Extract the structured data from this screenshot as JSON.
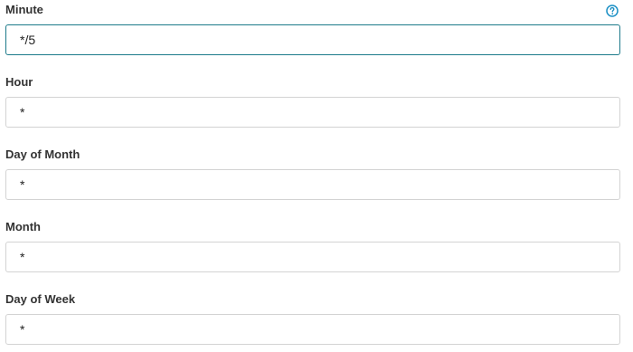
{
  "help_icon": "question-circle-icon",
  "accent_color": "#1c7a8a",
  "fields": [
    {
      "label": "Minute",
      "value": "*/5"
    },
    {
      "label": "Hour",
      "value": "*"
    },
    {
      "label": "Day of Month",
      "value": "*"
    },
    {
      "label": "Month",
      "value": "*"
    },
    {
      "label": "Day of Week",
      "value": "*"
    }
  ]
}
